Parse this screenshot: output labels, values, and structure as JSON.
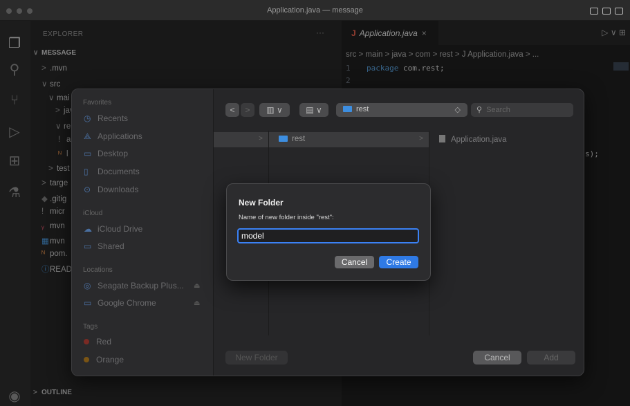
{
  "window": {
    "title": "Application.java — message"
  },
  "activity_bar": {
    "icons": [
      "files-icon",
      "search-icon",
      "source-control-icon",
      "run-debug-icon",
      "extensions-icon",
      "testing-icon",
      "account-icon"
    ]
  },
  "explorer": {
    "title": "EXPLORER",
    "more": "···",
    "project": "MESSAGE",
    "items": [
      {
        "label": ".mvn",
        "chevron": ">"
      },
      {
        "label": "src",
        "chevron": "∨"
      },
      {
        "label": "mai",
        "chevron": "∨"
      },
      {
        "label": "jav",
        "chevron": ">"
      },
      {
        "label": "re",
        "chevron": "∨"
      },
      {
        "label": "a",
        "chevron": "!"
      },
      {
        "label": "l",
        "chevron": ""
      },
      {
        "label": "test",
        "chevron": ">"
      },
      {
        "label": "targe",
        "chevron": ">"
      },
      {
        "label": ".gitig",
        "chevron": ""
      },
      {
        "label": "micr",
        "chevron": "!"
      },
      {
        "label": "mvn",
        "chevron": ""
      },
      {
        "label": "mvn",
        "chevron": ""
      },
      {
        "label": "pom.",
        "chevron": ""
      },
      {
        "label": "READ",
        "chevron": ""
      }
    ],
    "outline": "OUTLINE"
  },
  "editor": {
    "tab": {
      "label": "Application.java",
      "icon": "J",
      "close": "×"
    },
    "tab_actions": "▷ ∨ ⊞",
    "breadcrumb": "src > main > java > com > rest > J Application.java > ...",
    "lines": [
      {
        "num": "1",
        "keyword": "package",
        "rest": " com.rest;"
      },
      {
        "num": "2",
        "keyword": "",
        "rest": ""
      }
    ],
    "code_fragment": "s);"
  },
  "file_dialog": {
    "sidebar": {
      "favorites_header": "Favorites",
      "favorites": [
        {
          "label": "Recents",
          "icon": "clock-icon"
        },
        {
          "label": "Applications",
          "icon": "applications-icon"
        },
        {
          "label": "Desktop",
          "icon": "desktop-icon"
        },
        {
          "label": "Documents",
          "icon": "document-icon"
        },
        {
          "label": "Downloads",
          "icon": "download-icon"
        }
      ],
      "icloud_header": "iCloud",
      "icloud": [
        {
          "label": "iCloud Drive",
          "icon": "cloud-icon"
        },
        {
          "label": "Shared",
          "icon": "shared-folder-icon"
        }
      ],
      "locations_header": "Locations",
      "locations": [
        {
          "label": "Seagate Backup Plus...",
          "icon": "disk-icon",
          "eject": "⏏"
        },
        {
          "label": "Google Chrome",
          "icon": "disk-icon",
          "eject": "⏏"
        }
      ],
      "tags_header": "Tags",
      "tags": [
        {
          "label": "Red",
          "color": "#c0392b"
        },
        {
          "label": "Orange",
          "color": "#d68910"
        }
      ]
    },
    "toolbar": {
      "back": "<",
      "forward": ">",
      "view_columns": "▥ ∨",
      "view_group": "▤ ∨",
      "path": "rest",
      "path_chevron": "◇",
      "search_placeholder": "Search"
    },
    "columns": {
      "col2": {
        "label": "rest"
      },
      "col3": {
        "label": "Application.java"
      }
    },
    "bottom": {
      "new_folder": "New Folder",
      "cancel": "Cancel",
      "add": "Add"
    }
  },
  "new_folder_sheet": {
    "title": "New Folder",
    "label": "Name of new folder inside \"rest\":",
    "value": "model",
    "cancel": "Cancel",
    "create": "Create"
  }
}
